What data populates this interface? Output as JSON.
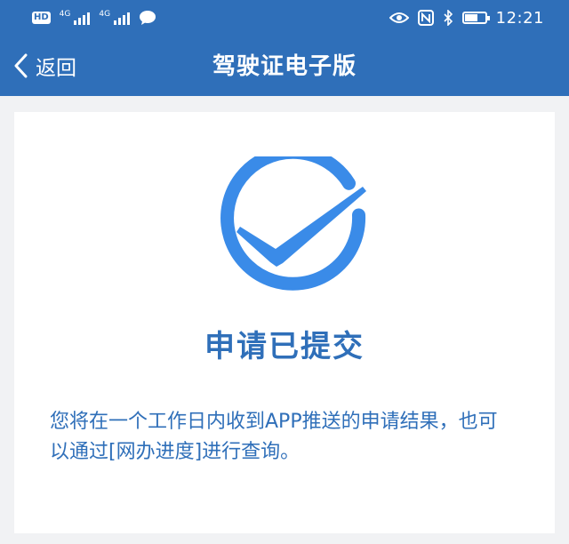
{
  "status_bar": {
    "hd_badge": "HD",
    "signal_1_tag": "4G",
    "signal_2_tag": "4G",
    "time": "12:21",
    "icons": [
      "hd-icon",
      "signal-icon",
      "signal-icon",
      "message-icon",
      "eye-icon",
      "nfc-icon",
      "bluetooth-icon",
      "battery-icon"
    ]
  },
  "nav": {
    "back_label": "返回",
    "title": "驾驶证电子版"
  },
  "result": {
    "icon": "check-circle-icon",
    "title": "申请已提交",
    "description": "您将在一个工作日内收到APP推送的申请结果，也可以通过[网办进度]进行查询。"
  },
  "colors": {
    "header_bg": "#2f6fb9",
    "check": "#3a8be8",
    "text_blue": "#2f6fb9",
    "page_bg": "#f1f2f4"
  }
}
